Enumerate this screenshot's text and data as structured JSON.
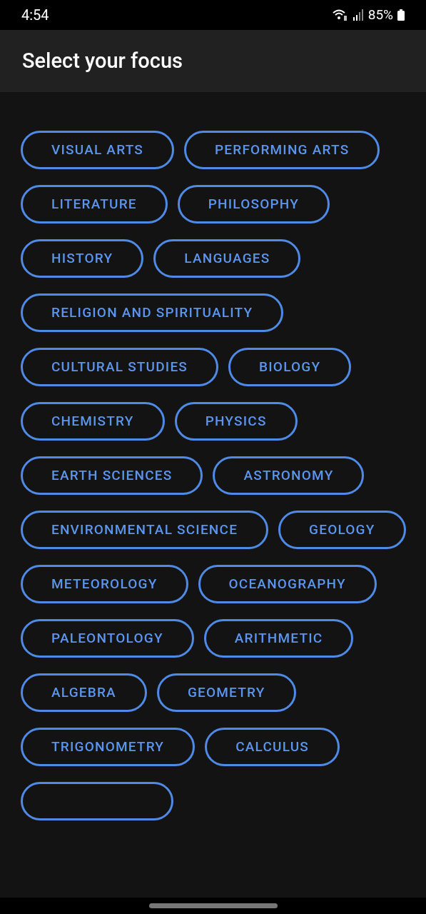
{
  "status_bar": {
    "time": "4:54",
    "battery": "85%"
  },
  "app_bar": {
    "title": "Select your focus"
  },
  "chips": [
    {
      "label": "VISUAL ARTS"
    },
    {
      "label": "PERFORMING ARTS"
    },
    {
      "label": "LITERATURE"
    },
    {
      "label": "PHILOSOPHY"
    },
    {
      "label": "HISTORY"
    },
    {
      "label": "LANGUAGES"
    },
    {
      "label": "RELIGION AND SPIRITUALITY"
    },
    {
      "label": "CULTURAL STUDIES"
    },
    {
      "label": "BIOLOGY"
    },
    {
      "label": "CHEMISTRY"
    },
    {
      "label": "PHYSICS"
    },
    {
      "label": "EARTH SCIENCES"
    },
    {
      "label": "ASTRONOMY"
    },
    {
      "label": "ENVIRONMENTAL SCIENCE"
    },
    {
      "label": "GEOLOGY"
    },
    {
      "label": "METEOROLOGY"
    },
    {
      "label": "OCEANOGRAPHY"
    },
    {
      "label": "PALEONTOLOGY"
    },
    {
      "label": "ARITHMETIC"
    },
    {
      "label": "ALGEBRA"
    },
    {
      "label": "GEOMETRY"
    },
    {
      "label": "TRIGONOMETRY"
    },
    {
      "label": "CALCULUS"
    }
  ]
}
